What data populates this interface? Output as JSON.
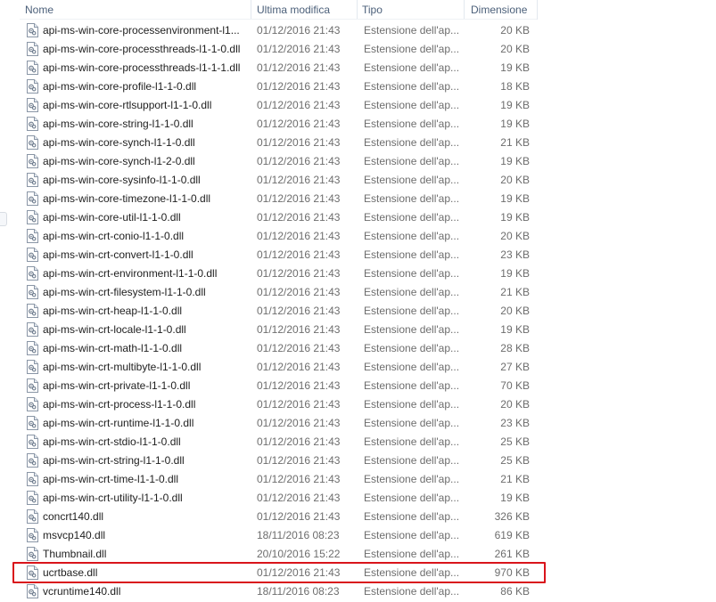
{
  "columns": {
    "name": "Nome",
    "date": "Ultima modifica",
    "type": "Tipo",
    "size": "Dimensione"
  },
  "file_icon": "dll-file-icon",
  "highlight_color": "#d9141b",
  "files": [
    {
      "name": "api-ms-win-core-processenvironment-l1...",
      "date": "01/12/2016 21:43",
      "type": "Estensione dell'ap...",
      "size": "20 KB"
    },
    {
      "name": "api-ms-win-core-processthreads-l1-1-0.dll",
      "date": "01/12/2016 21:43",
      "type": "Estensione dell'ap...",
      "size": "20 KB"
    },
    {
      "name": "api-ms-win-core-processthreads-l1-1-1.dll",
      "date": "01/12/2016 21:43",
      "type": "Estensione dell'ap...",
      "size": "19 KB"
    },
    {
      "name": "api-ms-win-core-profile-l1-1-0.dll",
      "date": "01/12/2016 21:43",
      "type": "Estensione dell'ap...",
      "size": "18 KB"
    },
    {
      "name": "api-ms-win-core-rtlsupport-l1-1-0.dll",
      "date": "01/12/2016 21:43",
      "type": "Estensione dell'ap...",
      "size": "19 KB"
    },
    {
      "name": "api-ms-win-core-string-l1-1-0.dll",
      "date": "01/12/2016 21:43",
      "type": "Estensione dell'ap...",
      "size": "19 KB"
    },
    {
      "name": "api-ms-win-core-synch-l1-1-0.dll",
      "date": "01/12/2016 21:43",
      "type": "Estensione dell'ap...",
      "size": "21 KB"
    },
    {
      "name": "api-ms-win-core-synch-l1-2-0.dll",
      "date": "01/12/2016 21:43",
      "type": "Estensione dell'ap...",
      "size": "19 KB"
    },
    {
      "name": "api-ms-win-core-sysinfo-l1-1-0.dll",
      "date": "01/12/2016 21:43",
      "type": "Estensione dell'ap...",
      "size": "20 KB"
    },
    {
      "name": "api-ms-win-core-timezone-l1-1-0.dll",
      "date": "01/12/2016 21:43",
      "type": "Estensione dell'ap...",
      "size": "19 KB"
    },
    {
      "name": "api-ms-win-core-util-l1-1-0.dll",
      "date": "01/12/2016 21:43",
      "type": "Estensione dell'ap...",
      "size": "19 KB"
    },
    {
      "name": "api-ms-win-crt-conio-l1-1-0.dll",
      "date": "01/12/2016 21:43",
      "type": "Estensione dell'ap...",
      "size": "20 KB"
    },
    {
      "name": "api-ms-win-crt-convert-l1-1-0.dll",
      "date": "01/12/2016 21:43",
      "type": "Estensione dell'ap...",
      "size": "23 KB"
    },
    {
      "name": "api-ms-win-crt-environment-l1-1-0.dll",
      "date": "01/12/2016 21:43",
      "type": "Estensione dell'ap...",
      "size": "19 KB"
    },
    {
      "name": "api-ms-win-crt-filesystem-l1-1-0.dll",
      "date": "01/12/2016 21:43",
      "type": "Estensione dell'ap...",
      "size": "21 KB"
    },
    {
      "name": "api-ms-win-crt-heap-l1-1-0.dll",
      "date": "01/12/2016 21:43",
      "type": "Estensione dell'ap...",
      "size": "20 KB"
    },
    {
      "name": "api-ms-win-crt-locale-l1-1-0.dll",
      "date": "01/12/2016 21:43",
      "type": "Estensione dell'ap...",
      "size": "19 KB"
    },
    {
      "name": "api-ms-win-crt-math-l1-1-0.dll",
      "date": "01/12/2016 21:43",
      "type": "Estensione dell'ap...",
      "size": "28 KB"
    },
    {
      "name": "api-ms-win-crt-multibyte-l1-1-0.dll",
      "date": "01/12/2016 21:43",
      "type": "Estensione dell'ap...",
      "size": "27 KB"
    },
    {
      "name": "api-ms-win-crt-private-l1-1-0.dll",
      "date": "01/12/2016 21:43",
      "type": "Estensione dell'ap...",
      "size": "70 KB"
    },
    {
      "name": "api-ms-win-crt-process-l1-1-0.dll",
      "date": "01/12/2016 21:43",
      "type": "Estensione dell'ap...",
      "size": "20 KB"
    },
    {
      "name": "api-ms-win-crt-runtime-l1-1-0.dll",
      "date": "01/12/2016 21:43",
      "type": "Estensione dell'ap...",
      "size": "23 KB"
    },
    {
      "name": "api-ms-win-crt-stdio-l1-1-0.dll",
      "date": "01/12/2016 21:43",
      "type": "Estensione dell'ap...",
      "size": "25 KB"
    },
    {
      "name": "api-ms-win-crt-string-l1-1-0.dll",
      "date": "01/12/2016 21:43",
      "type": "Estensione dell'ap...",
      "size": "25 KB"
    },
    {
      "name": "api-ms-win-crt-time-l1-1-0.dll",
      "date": "01/12/2016 21:43",
      "type": "Estensione dell'ap...",
      "size": "21 KB"
    },
    {
      "name": "api-ms-win-crt-utility-l1-1-0.dll",
      "date": "01/12/2016 21:43",
      "type": "Estensione dell'ap...",
      "size": "19 KB"
    },
    {
      "name": "concrt140.dll",
      "date": "01/12/2016 21:43",
      "type": "Estensione dell'ap...",
      "size": "326 KB"
    },
    {
      "name": "msvcp140.dll",
      "date": "18/11/2016 08:23",
      "type": "Estensione dell'ap...",
      "size": "619 KB"
    },
    {
      "name": "Thumbnail.dll",
      "date": "20/10/2016 15:22",
      "type": "Estensione dell'ap...",
      "size": "261 KB"
    },
    {
      "name": "ucrtbase.dll",
      "date": "01/12/2016 21:43",
      "type": "Estensione dell'ap...",
      "size": "970 KB",
      "highlighted": true
    },
    {
      "name": "vcruntime140.dll",
      "date": "18/11/2016 08:23",
      "type": "Estensione dell'ap...",
      "size": "86 KB"
    }
  ]
}
